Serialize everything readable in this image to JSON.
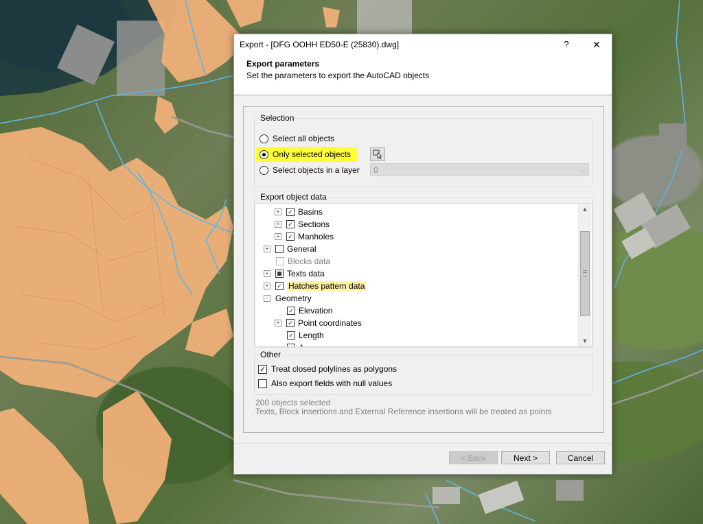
{
  "dialog": {
    "title": "Export - [DFG OOHH ED50-E (25830).dwg]",
    "help": "?",
    "close": "✕",
    "header_title": "Export parameters",
    "header_subtitle": "Set the parameters to export the AutoCAD objects"
  },
  "selection": {
    "group_label": "Selection",
    "options": [
      {
        "label": "Select all objects",
        "selected": false
      },
      {
        "label": "Only selected objects",
        "selected": true
      },
      {
        "label": "Select objects in a layer",
        "selected": false
      }
    ],
    "layer_value": "0",
    "pick_button_icon": "pick-objects-icon"
  },
  "export_object_data": {
    "group_label": "Export object data",
    "items": [
      {
        "label": "Basins",
        "level": 2,
        "expandable": true,
        "state": "checked"
      },
      {
        "label": "Sections",
        "level": 2,
        "expandable": true,
        "state": "checked"
      },
      {
        "label": "Manholes",
        "level": 2,
        "expandable": true,
        "state": "checked"
      },
      {
        "label": "General",
        "level": 1,
        "expandable": true,
        "state": "unchecked"
      },
      {
        "label": "Blocks data",
        "level": 1,
        "expandable": false,
        "state": "disabled"
      },
      {
        "label": "Texts data",
        "level": 1,
        "expandable": true,
        "state": "partial"
      },
      {
        "label": "Hatches pattern data",
        "level": 1,
        "expandable": true,
        "state": "checked",
        "highlighted": true
      },
      {
        "label": "Geometry",
        "level": 0,
        "expandable": true,
        "expanded": true,
        "state": "none"
      },
      {
        "label": "Elevation",
        "level": 2,
        "expandable": false,
        "state": "checked"
      },
      {
        "label": "Point coordinates",
        "level": 2,
        "expandable": true,
        "state": "checked"
      },
      {
        "label": "Length",
        "level": 2,
        "expandable": false,
        "state": "checked"
      },
      {
        "label": "A",
        "level": 2,
        "expandable": false,
        "state": "checked"
      }
    ]
  },
  "other": {
    "group_label": "Other",
    "options": [
      {
        "label": "Treat closed polylines as polygons",
        "checked": true
      },
      {
        "label": "Also export fields with null values",
        "checked": false
      }
    ]
  },
  "status": {
    "count": "200 objects selected",
    "note": "Texts, Block insertions and External Reference insertions will be treated as points"
  },
  "buttons": {
    "back": "< Back",
    "next": "Next >",
    "cancel": "Cancel"
  },
  "colors": {
    "highlight": "#ffff38",
    "selected_item": "#fff1a8",
    "parcel_fill": "#f2b27a",
    "network_line": "#5fb4e6"
  }
}
